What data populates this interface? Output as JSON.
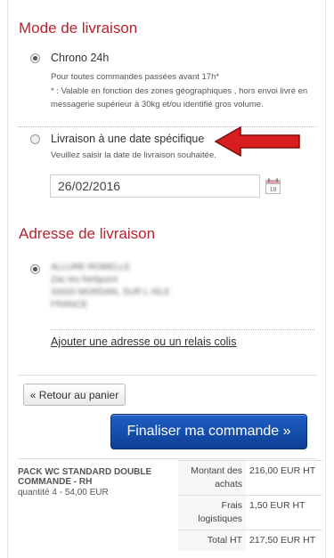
{
  "delivery": {
    "title": "Mode de livraison",
    "chrono": {
      "label": "Chrono 24h",
      "note1": "Pour toutes commandes passées avant 17h*",
      "note2a": "* : Valable en fonction des zones géographiques , hors envoi livré en",
      "note2b": "messagerie supérieur à 30kg et/ou identifié gros volume.",
      "selected": true
    },
    "specific_date": {
      "label": "Livraison à une date spécifique",
      "hint": "Veuillez saisir la date de livraison souhaitée.",
      "date_value": "26/02/2016",
      "selected": false
    },
    "calendar_icon": "calendar-icon",
    "calendar_day": "18",
    "arrow_icon": "red-arrow-left",
    "arrow_color": "#d81e1e"
  },
  "address": {
    "title": "Adresse de livraison",
    "lines": [
      "ALLURE ROMELLE",
      "Zac les Nettpoint",
      "33420 MORDAN, SUR L ISLE",
      "FRANCE"
    ],
    "selected": true,
    "add_link": "Ajouter une adresse ou un relais colis"
  },
  "actions": {
    "back_label": "« Retour au panier",
    "finalize_label": "Finaliser ma commande »"
  },
  "summary": {
    "product_name": "PACK WC STANDARD DOUBLE COMMANDE - RH",
    "quantity": "quantité 4 - 54,00 EUR",
    "rows": [
      {
        "label": "Montant des achats",
        "value": "216,00 EUR HT"
      },
      {
        "label": "Frais logistiques",
        "value": "1,50 EUR HT"
      },
      {
        "label": "Total HT",
        "value": "217,50 EUR HT"
      }
    ]
  },
  "colors": {
    "accent_red": "#b7222e",
    "button_blue": "#1f5fc4"
  }
}
